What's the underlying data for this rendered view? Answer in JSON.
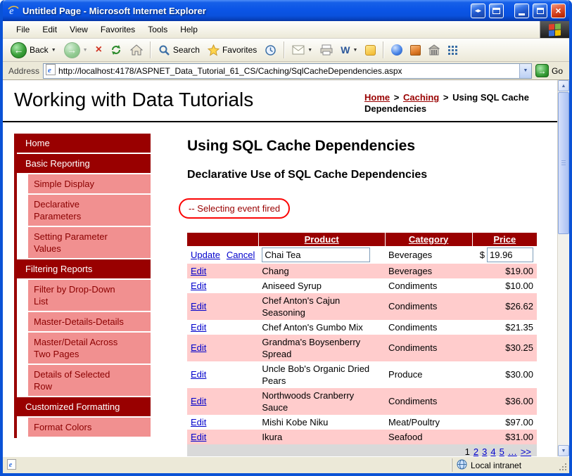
{
  "colors": {
    "title_bar_blue": "#0a55e6",
    "accent_dark_red": "#990000",
    "sidebar_subitem_pink": "#f19090",
    "grid_alt_row_pink": "#ffcccc",
    "pager_bg_gray": "#d9d9d9",
    "annotation_red": "#fb0505",
    "link_blue": "#0000cc"
  },
  "icons": {
    "back_arrow": "←",
    "forward_arrow": "→",
    "dropdown": "▼",
    "stop": "×",
    "word": "W",
    "go_arrow": "→",
    "nav_pair": "◀▶",
    "close": "×",
    "scroll_up": "▲",
    "scroll_down": "▼"
  },
  "window": {
    "title": "Untitled Page - Microsoft Internet Explorer"
  },
  "menubar": {
    "items": [
      "File",
      "Edit",
      "View",
      "Favorites",
      "Tools",
      "Help"
    ]
  },
  "toolbar": {
    "back_label": "Back",
    "search_label": "Search",
    "favorites_label": "Favorites"
  },
  "addressbar": {
    "label": "Address",
    "url": "http://localhost:4178/ASPNET_Data_Tutorial_61_CS/Caching/SqlCacheDependencies.aspx",
    "go_label": "Go"
  },
  "statusbar": {
    "zone_label": "Local intranet"
  },
  "page": {
    "site_title": "Working with Data Tutorials",
    "breadcrumb": {
      "home": "Home",
      "sep": ">",
      "section": "Caching",
      "current": "Using SQL Cache Dependencies"
    },
    "sidebar": {
      "items": [
        {
          "label": "Home"
        },
        {
          "label": "Basic Reporting"
        },
        {
          "label": "Simple Display"
        },
        {
          "label": "Declarative Parameters"
        },
        {
          "label": "Setting Parameter Values"
        },
        {
          "label": "Filtering Reports"
        },
        {
          "label": "Filter by Drop-Down List"
        },
        {
          "label": "Master-Details-Details"
        },
        {
          "label": "Master/Detail Across Two Pages"
        },
        {
          "label": "Details of Selected Row"
        },
        {
          "label": "Customized Formatting"
        },
        {
          "label": "Format Colors"
        }
      ]
    },
    "content": {
      "title": "Using SQL Cache Dependencies",
      "subtitle": "Declarative Use of SQL Cache Dependencies",
      "event_message": "-- Selecting event fired",
      "grid": {
        "headers": {
          "product": "Product",
          "category": "Category",
          "price": "Price"
        },
        "edit_row": {
          "update": "Update",
          "cancel": "Cancel",
          "product": "Chai Tea",
          "category": "Beverages",
          "currency": "$",
          "price": "19.96"
        },
        "rows": [
          {
            "edit": "Edit",
            "product": "Chang",
            "category": "Beverages",
            "price": "$19.00"
          },
          {
            "edit": "Edit",
            "product": "Aniseed Syrup",
            "category": "Condiments",
            "price": "$10.00"
          },
          {
            "edit": "Edit",
            "product": "Chef Anton's Cajun Seasoning",
            "category": "Condiments",
            "price": "$26.62"
          },
          {
            "edit": "Edit",
            "product": "Chef Anton's Gumbo Mix",
            "category": "Condiments",
            "price": "$21.35"
          },
          {
            "edit": "Edit",
            "product": "Grandma's Boysenberry Spread",
            "category": "Condiments",
            "price": "$30.25"
          },
          {
            "edit": "Edit",
            "product": "Uncle Bob's Organic Dried Pears",
            "category": "Produce",
            "price": "$30.00"
          },
          {
            "edit": "Edit",
            "product": "Northwoods Cranberry Sauce",
            "category": "Condiments",
            "price": "$36.00"
          },
          {
            "edit": "Edit",
            "product": "Mishi Kobe Niku",
            "category": "Meat/Poultry",
            "price": "$97.00"
          },
          {
            "edit": "Edit",
            "product": "Ikura",
            "category": "Seafood",
            "price": "$31.00"
          }
        ],
        "pager": {
          "current": "1",
          "links": [
            "2",
            "3",
            "4",
            "5",
            "…",
            ">>"
          ]
        }
      }
    }
  }
}
